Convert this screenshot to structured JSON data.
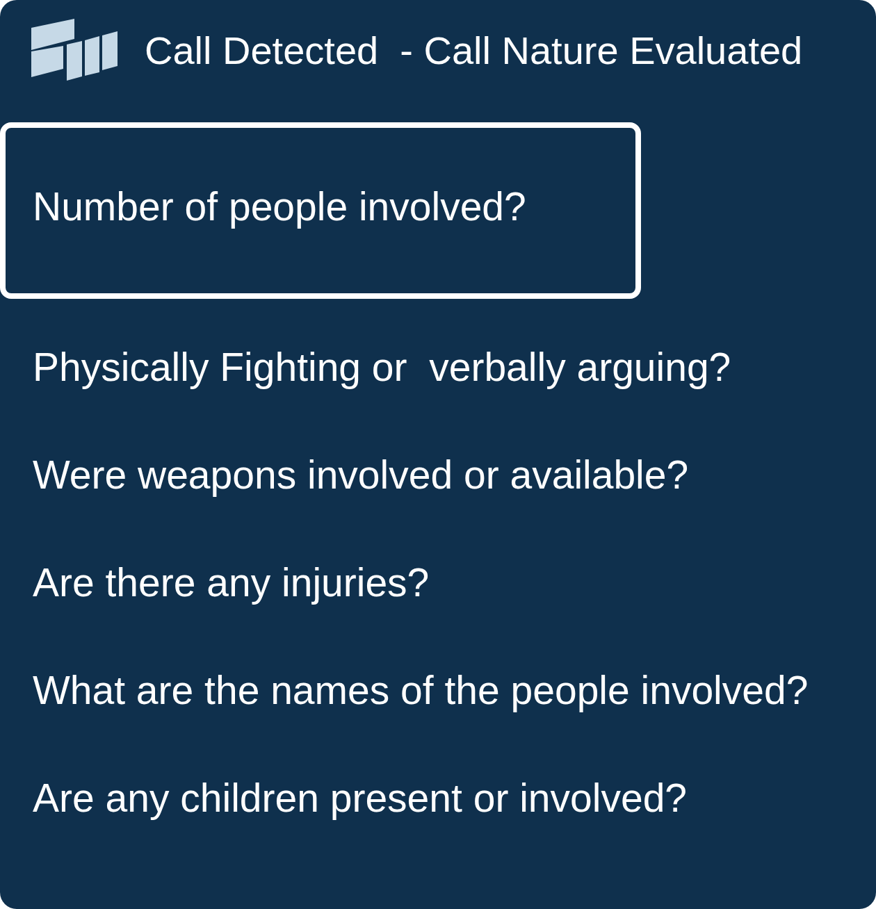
{
  "header": {
    "title": "Call Detected  - Call Nature Evaluated"
  },
  "questions": [
    {
      "text": "Number of people involved?",
      "selected": true
    },
    {
      "text": "Physically Fighting or  verbally arguing?",
      "selected": false
    },
    {
      "text": "Were weapons involved or available?",
      "selected": false
    },
    {
      "text": "Are there any injuries?",
      "selected": false
    },
    {
      "text": "What are the names of the people involved?",
      "selected": false
    },
    {
      "text": "Are any children present or involved?",
      "selected": false
    }
  ]
}
